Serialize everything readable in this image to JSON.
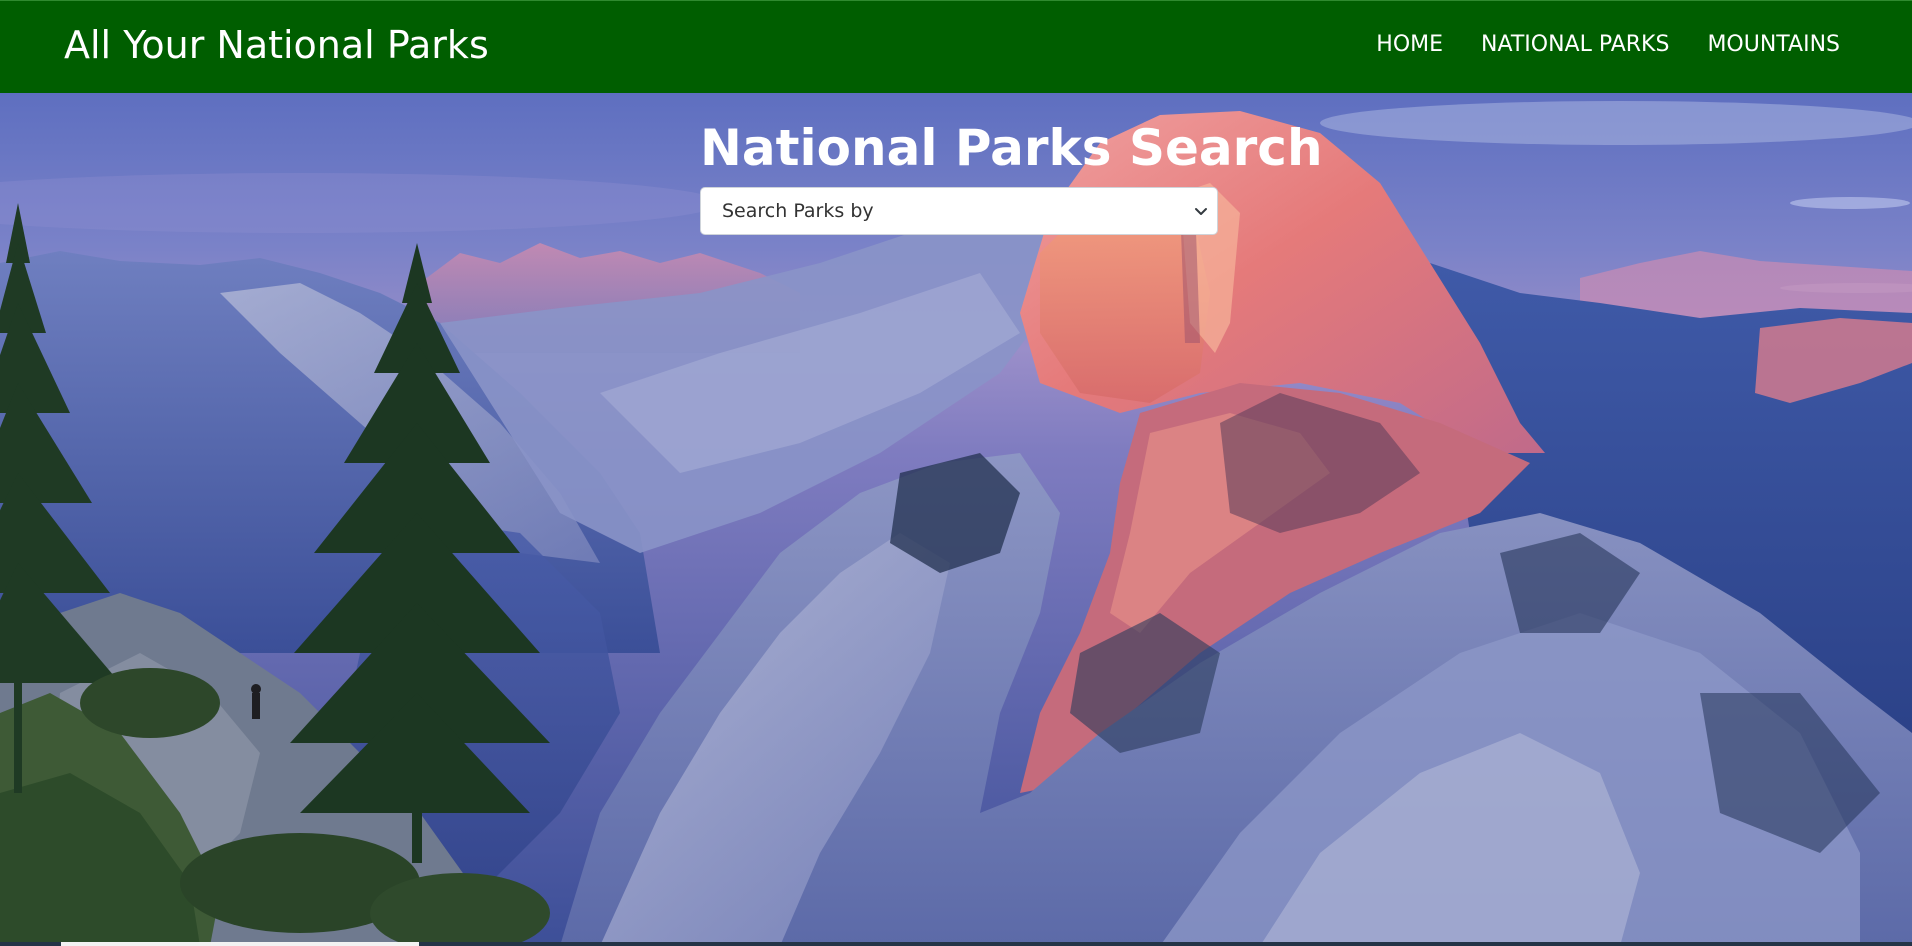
{
  "navbar": {
    "brand": "All Your National Parks",
    "links": [
      {
        "label": "HOME"
      },
      {
        "label": "NATIONAL PARKS"
      },
      {
        "label": "MOUNTAINS"
      }
    ],
    "background_color": "#005e00"
  },
  "hero": {
    "title": "National Parks Search",
    "search_select": {
      "selected": "Search Parks by",
      "icon": "chevron-down-icon"
    },
    "background_image": "Half Dome at sunset, Yosemite mountain landscape with pine trees"
  }
}
